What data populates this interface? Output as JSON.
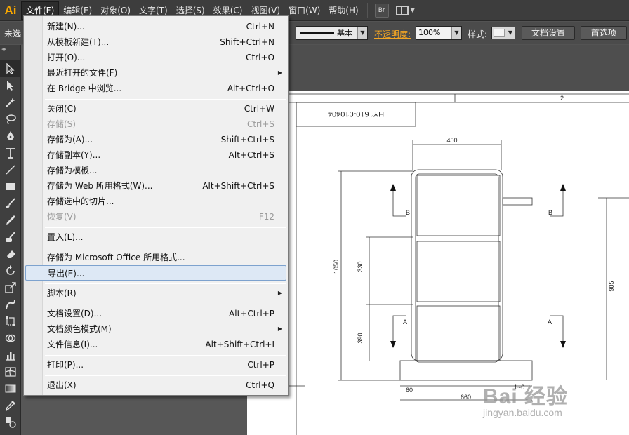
{
  "app": {
    "logo": "Ai"
  },
  "menubar": {
    "items": [
      {
        "label": "文件(F)",
        "active": true
      },
      {
        "label": "编辑(E)"
      },
      {
        "label": "对象(O)"
      },
      {
        "label": "文字(T)"
      },
      {
        "label": "选择(S)"
      },
      {
        "label": "效果(C)"
      },
      {
        "label": "视图(V)"
      },
      {
        "label": "窗口(W)"
      },
      {
        "label": "帮助(H)"
      }
    ],
    "bridge_button": "Br"
  },
  "controlbar": {
    "selection_label": "未选",
    "stroke_name": "基本",
    "opacity_label": "不透明度:",
    "opacity_value": "100%",
    "style_label": "样式:",
    "doc_settings": "文档设置",
    "preferences": "首选项"
  },
  "file_menu": {
    "items": [
      {
        "label": "新建(N)...",
        "shortcut": "Ctrl+N"
      },
      {
        "label": "从模板新建(T)...",
        "shortcut": "Shift+Ctrl+N"
      },
      {
        "label": "打开(O)...",
        "shortcut": "Ctrl+O"
      },
      {
        "label": "最近打开的文件(F)",
        "shortcut": "",
        "submenu": true
      },
      {
        "label": "在 Bridge 中浏览...",
        "shortcut": "Alt+Ctrl+O"
      },
      {
        "label": "关闭(C)",
        "shortcut": "Ctrl+W"
      },
      {
        "label": "存储(S)",
        "shortcut": "Ctrl+S",
        "disabled": true
      },
      {
        "label": "存储为(A)...",
        "shortcut": "Shift+Ctrl+S"
      },
      {
        "label": "存储副本(Y)...",
        "shortcut": "Alt+Ctrl+S"
      },
      {
        "label": "存储为模板...",
        "shortcut": ""
      },
      {
        "label": "存储为 Web 所用格式(W)...",
        "shortcut": "Alt+Shift+Ctrl+S"
      },
      {
        "label": "存储选中的切片...",
        "shortcut": ""
      },
      {
        "label": "恢复(V)",
        "shortcut": "F12",
        "disabled": true
      },
      {
        "label": "置入(L)...",
        "shortcut": ""
      },
      {
        "label": "存储为 Microsoft Office 所用格式...",
        "shortcut": ""
      },
      {
        "label": "导出(E)...",
        "shortcut": "",
        "highlighted": true
      },
      {
        "label": "脚本(R)",
        "shortcut": "",
        "submenu": true
      },
      {
        "label": "文档设置(D)...",
        "shortcut": "Alt+Ctrl+P"
      },
      {
        "label": "文档颜色模式(M)",
        "shortcut": "",
        "submenu": true
      },
      {
        "label": "文件信息(I)...",
        "shortcut": "Alt+Shift+Ctrl+I"
      },
      {
        "label": "打印(P)...",
        "shortcut": "Ctrl+P"
      },
      {
        "label": "退出(X)",
        "shortcut": "Ctrl+Q"
      }
    ]
  },
  "drawing": {
    "title_block": "HY1610-010404",
    "top_ruler_mark": "2",
    "dimensions": {
      "top_width": "450",
      "total_height": "1050",
      "upper_section": "330",
      "lower_section": "390",
      "right_height": "905",
      "base_left": "60",
      "base_width": "660",
      "base_right": "1~0"
    },
    "section_b": "B",
    "section_a": "A"
  },
  "watermark": {
    "brand": "Bai 经验",
    "url": "jingyan.baidu.com"
  },
  "colors": {
    "accent": "#f7a600",
    "opacity_label": "#f5a623",
    "menu_highlight": "#dde8f5"
  }
}
